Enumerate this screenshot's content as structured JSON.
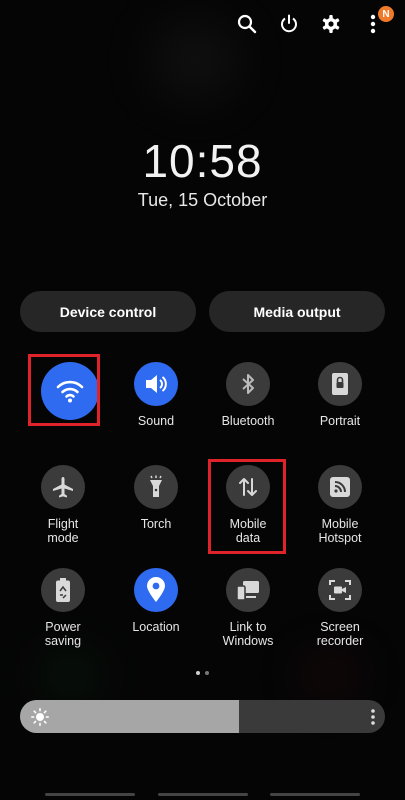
{
  "status_actions": {
    "icons": [
      "search-icon",
      "power-icon",
      "gear-icon",
      "more-vertical-icon"
    ],
    "notification_badge": "N"
  },
  "clock": {
    "time": "10:58",
    "date": "Tue, 15 October"
  },
  "buttons": {
    "device_control": "Device control",
    "media_output": "Media output"
  },
  "tiles": [
    {
      "id": "wifi",
      "label": "",
      "icon": "wifi-icon",
      "active": true,
      "highlighted": true
    },
    {
      "id": "sound",
      "label": "Sound",
      "icon": "volume-icon",
      "active": true
    },
    {
      "id": "bluetooth",
      "label": "Bluetooth",
      "icon": "bluetooth-icon",
      "active": false
    },
    {
      "id": "portrait",
      "label": "Portrait",
      "icon": "rotation-lock-icon",
      "active": false
    },
    {
      "id": "flight-mode",
      "label": "Flight\nmode",
      "icon": "airplane-icon",
      "active": false
    },
    {
      "id": "torch",
      "label": "Torch",
      "icon": "flashlight-icon",
      "active": false
    },
    {
      "id": "mobile-data",
      "label": "Mobile\ndata",
      "icon": "data-arrows-icon",
      "active": false,
      "highlighted": true
    },
    {
      "id": "mobile-hotspot",
      "label": "Mobile\nHotspot",
      "icon": "hotspot-icon",
      "active": false
    },
    {
      "id": "power-saving",
      "label": "Power\nsaving",
      "icon": "battery-recycle-icon",
      "active": false
    },
    {
      "id": "location",
      "label": "Location",
      "icon": "location-pin-icon",
      "active": true
    },
    {
      "id": "link-to-windows",
      "label": "Link to\nWindows",
      "icon": "link-windows-icon",
      "active": false
    },
    {
      "id": "screen-recorder",
      "label": "Screen\nrecorder",
      "icon": "screen-record-icon",
      "active": false
    }
  ],
  "page_indicator": {
    "current": 1,
    "total": 2
  },
  "brightness": {
    "level": 0.6
  },
  "colors": {
    "active": "#2f6bf0",
    "inactive": "#3b3b3b",
    "highlight": "#e0232a",
    "badge": "#f07a2a"
  }
}
